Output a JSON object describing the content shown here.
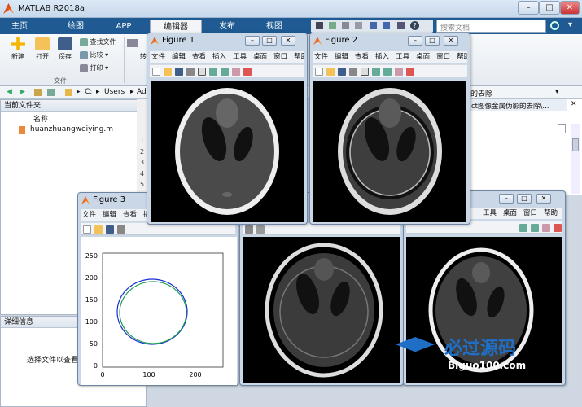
{
  "app": {
    "title": "MATLAB R2018a"
  },
  "tabs": [
    "主页",
    "绘图",
    "APP",
    "编辑器",
    "发布",
    "视图"
  ],
  "search": {
    "placeholder": "搜索文档"
  },
  "ribbon": {
    "new": "新建",
    "open": "打开",
    "save": "保存",
    "find_files": "查找文件",
    "compare": "比较",
    "print": "打印",
    "group_file": "文件",
    "goto": "转"
  },
  "address": {
    "c": "C:",
    "users": "Users",
    "ad": "Ad",
    "right_text": "的去除"
  },
  "editor_tab": {
    "text": "ct图像金属伪影的去除\\..."
  },
  "current_folder": {
    "title": "当前文件夹",
    "col_name": "名称",
    "file": "huanzhuangweiying.m"
  },
  "details": {
    "title": "详细信息",
    "hint": "选择文件以查看"
  },
  "line_numbers": [
    "1",
    "2",
    "3",
    "4",
    "5",
    "6",
    "7"
  ],
  "figures": {
    "f1": {
      "title": "Figure 1"
    },
    "f2": {
      "title": "Figure 2"
    },
    "f3": {
      "title": "Figure 3"
    }
  },
  "fig_menu": [
    "文件",
    "编辑",
    "查看",
    "插入",
    "工具",
    "桌面",
    "窗口",
    "帮助"
  ],
  "fig3_axis": {
    "yticks": [
      "250",
      "200",
      "150",
      "100",
      "50",
      "0"
    ],
    "xticks": [
      "0",
      "100",
      "200"
    ]
  },
  "watermark": {
    "brand": "必过源码",
    "url": "Biguo100.com"
  },
  "colors": {
    "tabbar": "#1f5b92",
    "accent_blue": "#2b6cb0"
  }
}
